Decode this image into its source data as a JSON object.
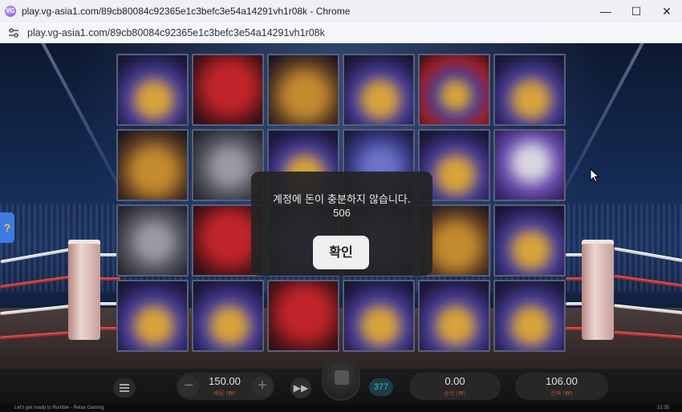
{
  "window": {
    "title": "play.vg-asia1.com/89cb80084c92365e1c3befc3e54a14291vh1r08k - Chrome",
    "favicon_text": "VG",
    "controls": {
      "minimize": "—",
      "maximize": "☐",
      "close": "✕"
    }
  },
  "address_bar": {
    "url": "play.vg-asia1.com/89cb80084c92365e1c3befc3e54a14291vh1r08k"
  },
  "dialog": {
    "message": "계정에 돈이 충분하지 않습니다.",
    "code": "506",
    "confirm_label": "확인"
  },
  "help_tab": {
    "label": "?"
  },
  "reels": {
    "symbols": [
      [
        "blue-gold",
        "red",
        "gold",
        "blue-gold",
        "red-blue",
        "blue-gold"
      ],
      [
        "gold",
        "silver",
        "blue-gold",
        "blue",
        "blue-gold",
        "purple-silver"
      ],
      [
        "silver",
        "red",
        "blue",
        "blue",
        "gold",
        "blue-gold"
      ],
      [
        "blue-gold",
        "blue-gold",
        "red",
        "blue-gold",
        "blue-gold",
        "blue-gold"
      ]
    ]
  },
  "controls": {
    "bet_value": "150.00",
    "bet_label": "베팅 (₩)",
    "minus": "−",
    "plus": "+",
    "turbo": "▶▶",
    "autoplay_count": "377",
    "win_value": "0.00",
    "win_label": "승리 (₩)",
    "balance_value": "106.00",
    "balance_label": "잔액 (₩)"
  },
  "footer": {
    "game_name": "Let's get ready to Rumble - Relax Gaming",
    "time": "21:35"
  },
  "colors": {
    "dialog_bg": "#242424",
    "autoplay_accent": "#39b7d0",
    "label_accent": "#b34a3a"
  }
}
